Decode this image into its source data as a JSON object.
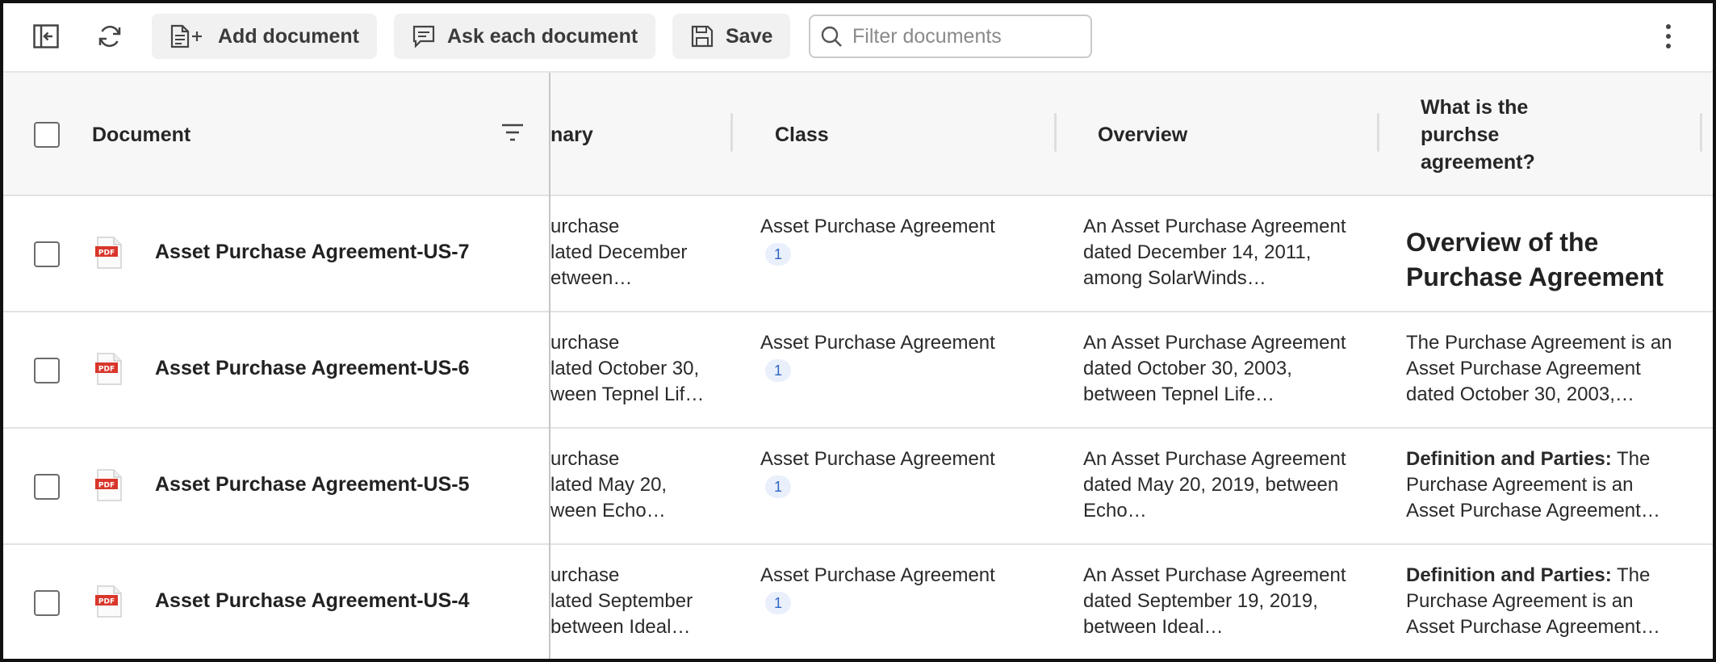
{
  "toolbar": {
    "add_document": "Add document",
    "ask_each": "Ask each document",
    "save": "Save",
    "filter_placeholder": "Filter documents"
  },
  "columns": {
    "document": "Document",
    "summary_partial": "nary",
    "class": "Class",
    "overview": "Overview",
    "question": "What is the purchse agreement?"
  },
  "rows": [
    {
      "name": "Asset Purchase Agreement-US-7",
      "summary": [
        "urchase",
        "lated December",
        "etween…"
      ],
      "class": "Asset Purchase Agreement",
      "class_count": "1",
      "overview": "An Asset Purchase Agreement dated December 14, 2011, among SolarWinds…",
      "answer_heading": "Overview of the Purchase Agreement"
    },
    {
      "name": "Asset Purchase Agreement-US-6",
      "summary": [
        "urchase",
        "lated October 30,",
        "ween Tepnel Lif…"
      ],
      "class": "Asset Purchase Agreement",
      "class_count": "1",
      "overview": "An Asset Purchase Agreement dated October 30, 2003, between Tepnel Life…",
      "answer_text": "The Purchase Agreement is an Asset Purchase Agreement dated October 30, 2003,…"
    },
    {
      "name": "Asset Purchase Agreement-US-5",
      "summary": [
        "urchase",
        "lated May 20,",
        "ween Echo…"
      ],
      "class": "Asset Purchase Agreement",
      "class_count": "1",
      "overview": "An Asset Purchase Agreement dated May 20, 2019, between Echo…",
      "answer_bold": "Definition and Parties:",
      "answer_rest": " The Purchase Agreement is an Asset Purchase Agreement…"
    },
    {
      "name": "Asset Purchase Agreement-US-4",
      "summary": [
        "urchase",
        "lated September",
        "between Ideal…"
      ],
      "class": "Asset Purchase Agreement",
      "class_count": "1",
      "overview": "An Asset Purchase Agreement dated September 19, 2019, between Ideal…",
      "answer_bold": "Definition and Parties:",
      "answer_rest": " The Purchase Agreement is an Asset Purchase Agreement…"
    }
  ],
  "icons": {
    "collapse": "sidebar-collapse-icon",
    "refresh": "refresh-icon",
    "add_doc": "document-plus-icon",
    "ask": "chat-bubble-icon",
    "save": "floppy-disk-icon",
    "search": "search-icon",
    "more": "more-vertical-icon",
    "filter": "filter-lines-icon",
    "pdf": "pdf-file-icon"
  },
  "colors": {
    "badge_bg": "#e9f0fb",
    "badge_text": "#2f66c4",
    "pdf_red": "#d9362b"
  }
}
